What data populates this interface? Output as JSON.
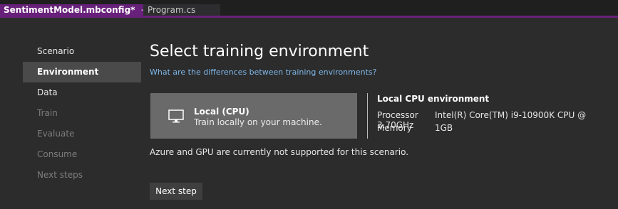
{
  "tabs": {
    "active": {
      "title": "SentimentModel.mbconfig*",
      "pin_icon": "pin-icon",
      "close_icon": "close-icon",
      "pin_glyph": "⊣",
      "close_glyph": "✕"
    },
    "inactive": {
      "title": "Program.cs"
    }
  },
  "sidebar": {
    "items": [
      {
        "label": "Scenario",
        "state": "enabled"
      },
      {
        "label": "Environment",
        "state": "selected"
      },
      {
        "label": "Data",
        "state": "enabled"
      },
      {
        "label": "Train",
        "state": "disabled"
      },
      {
        "label": "Evaluate",
        "state": "disabled"
      },
      {
        "label": "Consume",
        "state": "disabled"
      },
      {
        "label": "Next steps",
        "state": "disabled"
      }
    ]
  },
  "main": {
    "title": "Select training environment",
    "help_link": "What are the differences between training environments?",
    "env_card": {
      "icon": "monitor-icon",
      "title": "Local (CPU)",
      "description": "Train locally on your machine."
    },
    "details": {
      "title": "Local CPU environment",
      "processor_label": "Processor",
      "processor_value": "Intel(R) Core(TM) i9-10900K CPU @ 3.70GHz",
      "memory_label": "Memory",
      "memory_value": "1GB"
    },
    "notice": "Azure and GPU are currently not supported for this scenario.",
    "next_button": "Next step"
  },
  "colors": {
    "background": "#2c2c2c",
    "accent": "#68217a",
    "link": "#7fb6e8",
    "card": "#6a6a6a",
    "nav_selected": "#4a4a4a"
  }
}
